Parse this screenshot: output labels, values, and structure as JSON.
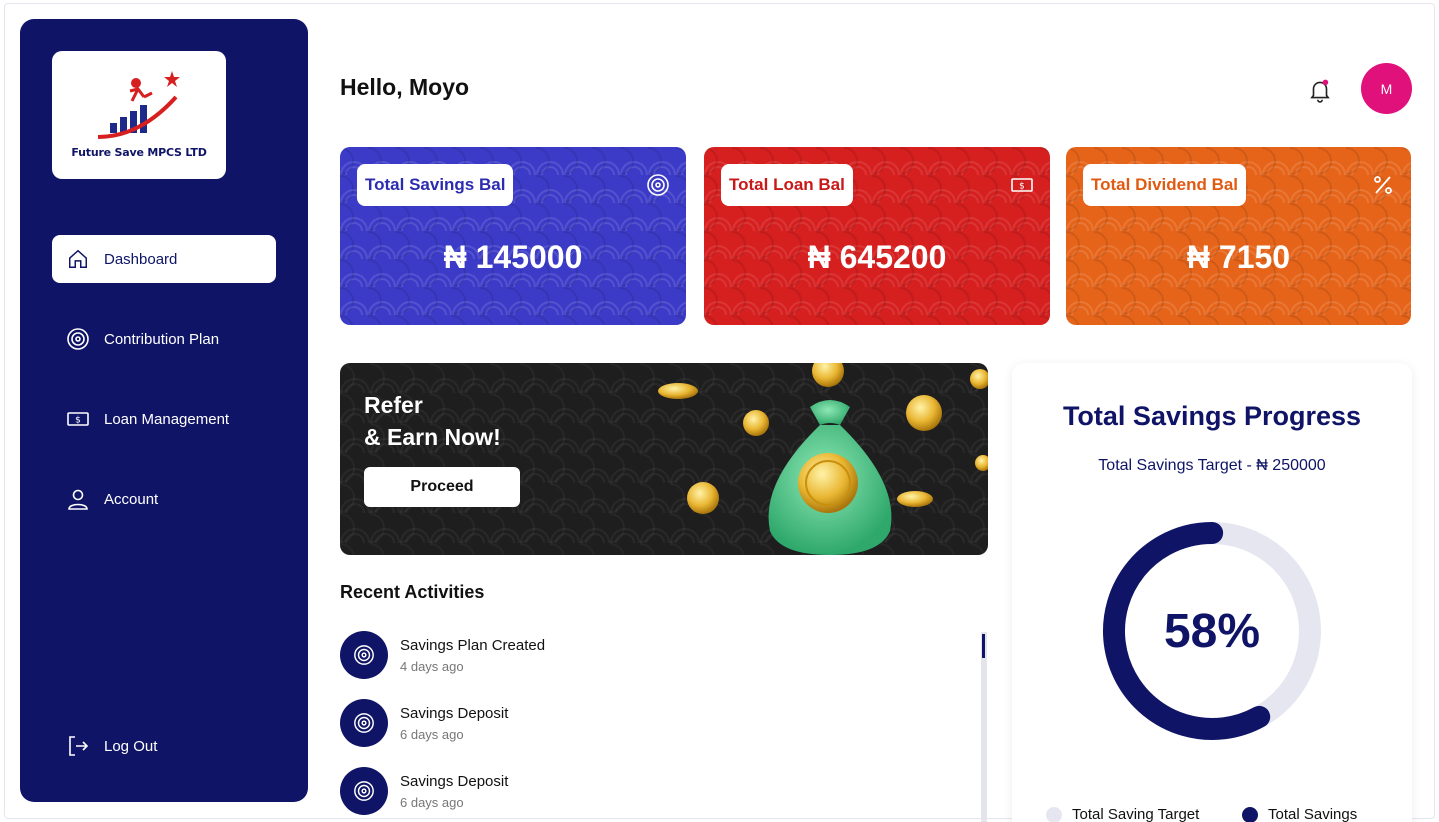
{
  "sidebar": {
    "logo_text": "Future Save MPCS LTD",
    "items": [
      {
        "label": "Dashboard",
        "icon": "home-icon",
        "active": true
      },
      {
        "label": "Contribution Plan",
        "icon": "target-icon"
      },
      {
        "label": "Loan Management",
        "icon": "cash-icon"
      },
      {
        "label": "Account",
        "icon": "user-icon"
      }
    ],
    "logout_label": "Log Out"
  },
  "header": {
    "greeting": "Hello, Moyo",
    "avatar_initial": "M"
  },
  "cards": [
    {
      "label": "Total Savings Bal",
      "amount": "₦ 145000",
      "icon": "target-icon",
      "color": "#3b3bc8"
    },
    {
      "label": "Total Loan Bal",
      "amount": "₦ 645200",
      "icon": "cash-icon",
      "color": "#d61f1f"
    },
    {
      "label": "Total Dividend Bal",
      "amount": "₦ 7150",
      "icon": "percent-icon",
      "color": "#e6641a"
    }
  ],
  "banner": {
    "line1": "Refer",
    "line2": "& Earn Now!",
    "button": "Proceed"
  },
  "activities": {
    "title": "Recent Activities",
    "items": [
      {
        "title": "Savings Plan Created",
        "time": "4 days ago"
      },
      {
        "title": "Savings Deposit",
        "time": "6 days ago"
      },
      {
        "title": "Savings Deposit",
        "time": "6 days ago"
      }
    ]
  },
  "progress": {
    "title": "Total Savings Progress",
    "target_text": "Total Savings Target - ₦ 250000",
    "percent_label": "58%",
    "percent_value": 0.58,
    "legend_target": "Total Saving Target",
    "legend_savings": "Total Savings",
    "colors": {
      "filled": "#0f1466",
      "track": "#e6e6f0"
    }
  }
}
